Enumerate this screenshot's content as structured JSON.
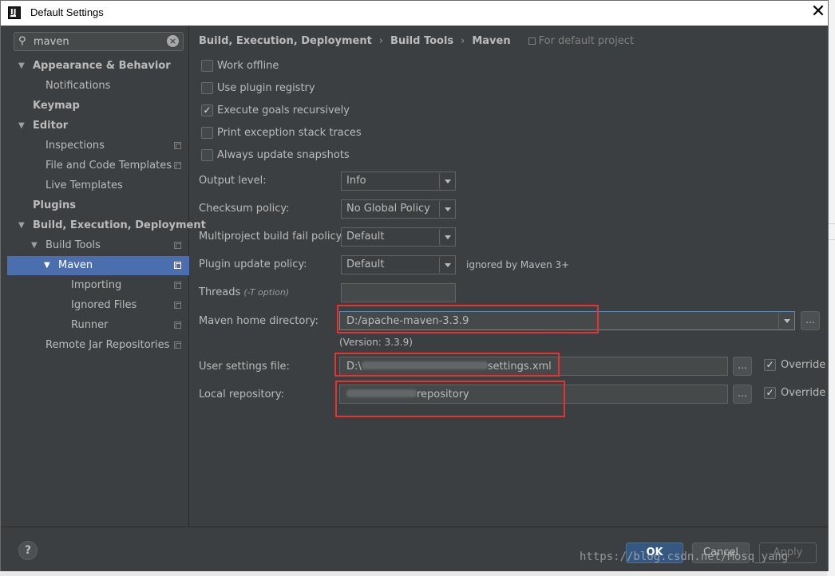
{
  "window": {
    "title": "Default Settings"
  },
  "search": {
    "value": "maven"
  },
  "sidebar": {
    "items": [
      {
        "label": "Appearance & Behavior"
      },
      {
        "label": "Notifications"
      },
      {
        "label": "Keymap"
      },
      {
        "label": "Editor"
      },
      {
        "label": "Inspections"
      },
      {
        "label": "File and Code Templates"
      },
      {
        "label": "Live Templates"
      },
      {
        "label": "Plugins"
      },
      {
        "label": "Build, Execution, Deployment"
      },
      {
        "label": "Build Tools"
      },
      {
        "label": "Maven"
      },
      {
        "label": "Importing"
      },
      {
        "label": "Ignored Files"
      },
      {
        "label": "Runner"
      },
      {
        "label": "Remote Jar Repositories"
      }
    ]
  },
  "breadcrumb": {
    "part1": "Build, Execution, Deployment",
    "part2": "Build Tools",
    "part3": "Maven",
    "scope": "For default project"
  },
  "checkboxes": [
    {
      "label": "Work offline",
      "checked": false
    },
    {
      "label": "Use plugin registry",
      "checked": false
    },
    {
      "label": "Execute goals recursively",
      "checked": true
    },
    {
      "label": "Print exception stack traces",
      "checked": false
    },
    {
      "label": "Always update snapshots",
      "checked": false
    }
  ],
  "form": {
    "output_level": {
      "label": "Output level:",
      "value": "Info"
    },
    "checksum_policy": {
      "label": "Checksum policy:",
      "value": "No Global Policy"
    },
    "fail_policy": {
      "label": "Multiproject build fail policy:",
      "value": "Default"
    },
    "plugin_update": {
      "label": "Plugin update policy:",
      "value": "Default",
      "note": "ignored by Maven 3+"
    },
    "threads": {
      "label": "Threads",
      "hint": "(-T option)",
      "value": ""
    },
    "maven_home": {
      "label": "Maven home directory:",
      "value": "D:/apache-maven-3.3.9",
      "version": "(Version: 3.3.9)"
    },
    "user_settings": {
      "label": "User settings file:",
      "prefix": "D:\\",
      "suffix": "settings.xml",
      "override": "Override"
    },
    "local_repo": {
      "label": "Local repository:",
      "suffix": "repository",
      "override": "Override"
    }
  },
  "buttons": {
    "ok": "OK",
    "cancel": "Cancel",
    "apply": "Apply",
    "browse": "...",
    "help": "?"
  },
  "watermark": "https://blog.csdn.net/Mosq_yang"
}
